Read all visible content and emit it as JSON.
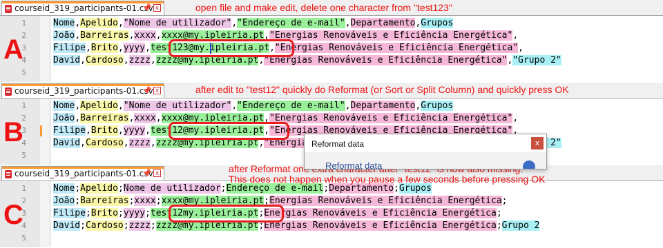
{
  "tab": {
    "filename": "courseid_319_participants-01.csv",
    "pin_glyph": "📌",
    "close_glyph": "x"
  },
  "line_numbers": [
    "1",
    "2",
    "3",
    "4",
    "5"
  ],
  "panels": [
    {
      "marker": "A",
      "annotation": [
        "open file and make edit, delete one character from  \"test123\""
      ],
      "lines": [
        [
          [
            "Nome",
            0
          ],
          [
            ",",
            7
          ],
          [
            "Apelido",
            1
          ],
          [
            ",",
            7
          ],
          [
            "\"Nome de utilizador\"",
            2
          ],
          [
            ",",
            7
          ],
          [
            "\"Endereço de e-mail\"",
            3
          ],
          [
            ",",
            7
          ],
          [
            "Departamento",
            4
          ],
          [
            ",",
            7
          ],
          [
            "Grupos",
            5
          ]
        ],
        [
          [
            "João",
            0
          ],
          [
            ",",
            7
          ],
          [
            "Barreiras",
            1
          ],
          [
            ",",
            7
          ],
          [
            "xxxx",
            2
          ],
          [
            ",",
            7
          ],
          [
            "xxxx@my.ipleiria.pt",
            3
          ],
          [
            ",",
            7
          ],
          [
            "\"Energias Renováveis e Eficiência Energética\"",
            4
          ],
          [
            ",",
            7
          ]
        ],
        [
          [
            "Filipe",
            0
          ],
          [
            ",",
            7
          ],
          [
            "Brito",
            1
          ],
          [
            ",",
            7
          ],
          [
            "yyyy",
            2
          ],
          [
            ",",
            7
          ],
          [
            "test123@my.ipleiria.pt",
            3
          ],
          [
            ",",
            7
          ],
          [
            "\"Energias Renováveis e Eficiência Energética\"",
            4
          ],
          [
            ",",
            7
          ]
        ],
        [
          [
            "David",
            0
          ],
          [
            ",",
            7
          ],
          [
            "Cardoso",
            1
          ],
          [
            ",",
            7
          ],
          [
            "zzzz",
            2
          ],
          [
            ",",
            7
          ],
          [
            "zzzz@my.ipleiria.pt",
            3
          ],
          [
            ",",
            7
          ],
          [
            "\"Energias Renováveis e Eficiência Energética\"",
            4
          ],
          [
            ",",
            7
          ],
          [
            "\"Grupo 2\"",
            5
          ]
        ],
        []
      ]
    },
    {
      "marker": "B",
      "annotation": [
        "after edit to \"test12\" quickly do Reformat (or Sort or Split Column) and quickly press OK"
      ],
      "lines": [
        [
          [
            "Nome",
            0
          ],
          [
            ",",
            7
          ],
          [
            "Apelido",
            1
          ],
          [
            ",",
            7
          ],
          [
            "\"Nome de utilizador\"",
            2
          ],
          [
            ",",
            7
          ],
          [
            "\"Endereço de e-mail\"",
            3
          ],
          [
            ",",
            7
          ],
          [
            "Departamento",
            4
          ],
          [
            ",",
            7
          ],
          [
            "Grupos",
            5
          ]
        ],
        [
          [
            "João",
            0
          ],
          [
            ",",
            7
          ],
          [
            "Barreiras",
            1
          ],
          [
            ",",
            7
          ],
          [
            "xxxx",
            2
          ],
          [
            ",",
            7
          ],
          [
            "xxxx@my.ipleiria.pt",
            3
          ],
          [
            ",",
            7
          ],
          [
            "\"Energias Renováveis e Eficiência Energética\"",
            4
          ],
          [
            ",",
            7
          ]
        ],
        [
          [
            "Filipe",
            0
          ],
          [
            ",",
            7
          ],
          [
            "Brito",
            1
          ],
          [
            ",",
            7
          ],
          [
            "yyyy",
            2
          ],
          [
            ",",
            7
          ],
          [
            "test12@my.ipleiria.pt",
            3
          ],
          [
            ",",
            7
          ],
          [
            "\"Energias Renováveis e Eficiência Energética\"",
            4
          ],
          [
            ",",
            7
          ]
        ],
        [
          [
            "David",
            0
          ],
          [
            ",",
            7
          ],
          [
            "Cardoso",
            1
          ],
          [
            ",",
            7
          ],
          [
            "zzzz",
            2
          ],
          [
            ",",
            7
          ],
          [
            "zzzz@my.ipleiria.pt",
            3
          ],
          [
            ",",
            7
          ],
          [
            "\"Energias Renováveis e Eficiência Energética\"",
            4
          ],
          [
            ",",
            7
          ],
          [
            "\"Grupo 2\"",
            5
          ]
        ],
        []
      ]
    },
    {
      "marker": "C",
      "annotation": [
        "after Reformat one extra character after \"test12\" is now also missing.",
        "This does not happen when you pause a few seconds before pressing OK"
      ],
      "lines": [
        [
          [
            "Nome",
            0
          ],
          [
            ";",
            7
          ],
          [
            "Apelido",
            1
          ],
          [
            ";",
            7
          ],
          [
            "Nome de utilizador",
            2
          ],
          [
            ";",
            7
          ],
          [
            "Endereço de e-mail",
            3
          ],
          [
            ";",
            7
          ],
          [
            "Departamento",
            4
          ],
          [
            ";",
            7
          ],
          [
            "Grupos",
            5
          ]
        ],
        [
          [
            "João",
            0
          ],
          [
            ";",
            7
          ],
          [
            "Barreiras",
            1
          ],
          [
            ";",
            7
          ],
          [
            "xxxx",
            2
          ],
          [
            ";",
            7
          ],
          [
            "xxxx@my.ipleiria.pt",
            3
          ],
          [
            ";",
            7
          ],
          [
            "Energias Renováveis e Eficiência Energética",
            4
          ],
          [
            ";",
            7
          ]
        ],
        [
          [
            "Filipe",
            0
          ],
          [
            ";",
            7
          ],
          [
            "Brito",
            1
          ],
          [
            ";",
            7
          ],
          [
            "yyyy",
            2
          ],
          [
            ";",
            7
          ],
          [
            "test12my.ipleiria.pt",
            3
          ],
          [
            ";",
            7
          ],
          [
            "Energias Renováveis e Eficiência Energética",
            4
          ],
          [
            ";",
            7
          ]
        ],
        [
          [
            "David",
            0
          ],
          [
            ";",
            7
          ],
          [
            "Cardoso",
            1
          ],
          [
            ";",
            7
          ],
          [
            "zzzz",
            2
          ],
          [
            ";",
            7
          ],
          [
            "zzzz@my.ipleiria.pt",
            3
          ],
          [
            ";",
            7
          ],
          [
            "Energias Renováveis e Eficiência Energética",
            4
          ],
          [
            ";",
            7
          ],
          [
            "Grupo 2",
            5
          ]
        ],
        []
      ]
    }
  ],
  "dialog": {
    "title": "Reformat data",
    "close_glyph": "x",
    "subtitle": "Reformat data"
  },
  "colors": {
    "annotation": "#ee1111",
    "tab_accent": "#ff9a33",
    "columns": [
      "#bfe9f7",
      "#fbf7a8",
      "#f0c6e8",
      "#9af09a",
      "#f5b8d8",
      "#a8f0f5",
      "#d0f0b0",
      "#ffffff"
    ]
  }
}
